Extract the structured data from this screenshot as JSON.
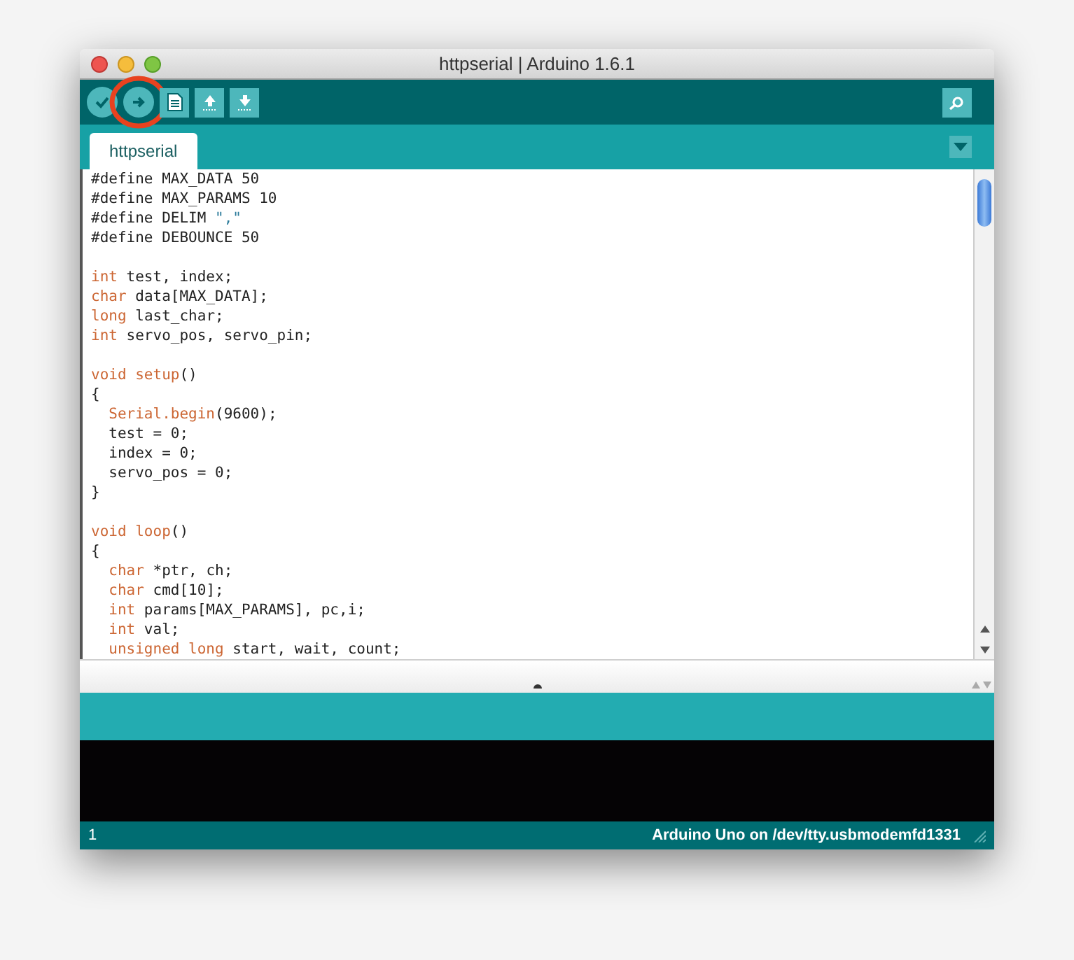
{
  "window": {
    "title": "httpserial | Arduino 1.6.1"
  },
  "toolbar": {
    "buttons": [
      {
        "kind": "verify",
        "highlighted": false
      },
      {
        "kind": "upload",
        "highlighted": true
      },
      {
        "kind": "new",
        "highlighted": false
      },
      {
        "kind": "open",
        "highlighted": false
      },
      {
        "kind": "save",
        "highlighted": false
      }
    ]
  },
  "tabs": [
    {
      "label": "httpserial",
      "selected": true
    }
  ],
  "editor": {
    "lines": [
      {
        "kind": "code",
        "segments": [
          {
            "kind": "plain",
            "text": "#define MAX_DATA 50"
          }
        ]
      },
      {
        "kind": "code",
        "segments": [
          {
            "kind": "plain",
            "text": "#define MAX_PARAMS 10"
          }
        ]
      },
      {
        "kind": "code",
        "segments": [
          {
            "kind": "plain",
            "text": "#define DELIM "
          },
          {
            "kind": "string",
            "text": "\",\""
          }
        ]
      },
      {
        "kind": "code",
        "segments": [
          {
            "kind": "plain",
            "text": "#define DEBOUNCE 50"
          }
        ]
      },
      {
        "kind": "blank"
      },
      {
        "kind": "code",
        "segments": [
          {
            "kind": "keyword",
            "text": "int"
          },
          {
            "kind": "plain",
            "text": " test, index;"
          }
        ]
      },
      {
        "kind": "code",
        "segments": [
          {
            "kind": "keyword",
            "text": "char"
          },
          {
            "kind": "plain",
            "text": " data[MAX_DATA];"
          }
        ]
      },
      {
        "kind": "code",
        "segments": [
          {
            "kind": "keyword",
            "text": "long"
          },
          {
            "kind": "plain",
            "text": " last_char;"
          }
        ]
      },
      {
        "kind": "code",
        "segments": [
          {
            "kind": "keyword",
            "text": "int"
          },
          {
            "kind": "plain",
            "text": " servo_pos, servo_pin;"
          }
        ]
      },
      {
        "kind": "blank"
      },
      {
        "kind": "code",
        "segments": [
          {
            "kind": "keyword",
            "text": "void setup"
          },
          {
            "kind": "plain",
            "text": "()"
          }
        ]
      },
      {
        "kind": "code",
        "segments": [
          {
            "kind": "plain",
            "text": "{"
          }
        ]
      },
      {
        "kind": "code",
        "segments": [
          {
            "kind": "keyword",
            "text": "  Serial.begin"
          },
          {
            "kind": "plain",
            "text": "(9600);"
          }
        ]
      },
      {
        "kind": "code",
        "segments": [
          {
            "kind": "plain",
            "text": "  test = 0;"
          }
        ]
      },
      {
        "kind": "code",
        "segments": [
          {
            "kind": "plain",
            "text": "  index = 0;"
          }
        ]
      },
      {
        "kind": "code",
        "segments": [
          {
            "kind": "plain",
            "text": "  servo_pos = 0;"
          }
        ]
      },
      {
        "kind": "code",
        "segments": [
          {
            "kind": "plain",
            "text": "}"
          }
        ]
      },
      {
        "kind": "blank"
      },
      {
        "kind": "code",
        "segments": [
          {
            "kind": "keyword",
            "text": "void loop"
          },
          {
            "kind": "plain",
            "text": "()"
          }
        ]
      },
      {
        "kind": "code",
        "segments": [
          {
            "kind": "plain",
            "text": "{"
          }
        ]
      },
      {
        "kind": "code",
        "segments": [
          {
            "kind": "keyword",
            "text": "  char"
          },
          {
            "kind": "plain",
            "text": " *ptr, ch;"
          }
        ]
      },
      {
        "kind": "code",
        "segments": [
          {
            "kind": "keyword",
            "text": "  char"
          },
          {
            "kind": "plain",
            "text": " cmd[10];"
          }
        ]
      },
      {
        "kind": "code",
        "segments": [
          {
            "kind": "keyword",
            "text": "  int"
          },
          {
            "kind": "plain",
            "text": " params[MAX_PARAMS], pc,i;"
          }
        ]
      },
      {
        "kind": "code",
        "segments": [
          {
            "kind": "keyword",
            "text": "  int"
          },
          {
            "kind": "plain",
            "text": " val;"
          }
        ]
      },
      {
        "kind": "code",
        "segments": [
          {
            "kind": "keyword",
            "text": "  unsigned long"
          },
          {
            "kind": "plain",
            "text": " start, wait, count;"
          }
        ]
      }
    ]
  },
  "status_bar": {
    "line": "1",
    "board": "Arduino Uno on /dev/tty.usbmodemfd1331"
  }
}
